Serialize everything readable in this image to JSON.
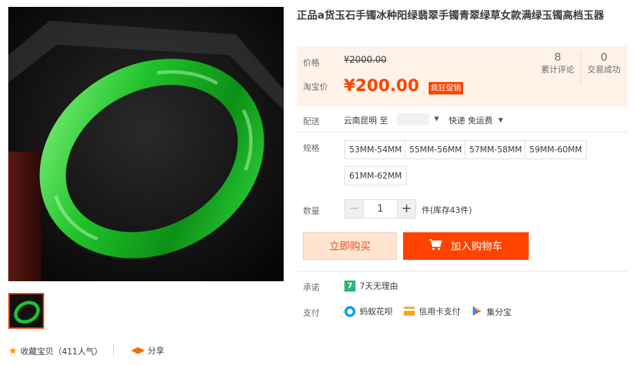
{
  "product": {
    "title": "正品a货玉石手镯冰种阳绿翡翠手镯青翠绿草女款满绿玉镯高档玉器"
  },
  "price": {
    "label": "价格",
    "original": "¥2000.00",
    "promo_label": "淘宝价",
    "promo_value": "¥200.00",
    "promo_badge": "疯狂促销"
  },
  "stats": {
    "reviews_count": "8",
    "reviews_label": "累计评论",
    "sales_count": "0",
    "sales_label": "交易成功"
  },
  "delivery": {
    "label": "配送",
    "from": "云南昆明 至",
    "method": "快递 免运费"
  },
  "spec": {
    "label": "规格",
    "options": [
      "53MM-54MM",
      "55MM-56MM",
      "57MM-58MM",
      "59MM-60MM",
      "61MM-62MM"
    ]
  },
  "quantity": {
    "label": "数量",
    "value": "1",
    "minus": "−",
    "plus": "+",
    "stock_text": "件(库存43件)"
  },
  "actions": {
    "buy_now": "立即购买",
    "add_to_cart": "加入购物车"
  },
  "promise": {
    "label": "承诺",
    "text": "7天无理由",
    "icon_glyph": "7"
  },
  "payment": {
    "label": "支付",
    "methods": [
      "蚂蚁花呗",
      "信用卡支付",
      "集分宝"
    ]
  },
  "footer": {
    "favorite": "收藏宝贝（411人气）",
    "share": "分享"
  },
  "colors": {
    "accent": "#ff4400",
    "price_bg": "#fff2e8",
    "jade": "#22c22a"
  }
}
